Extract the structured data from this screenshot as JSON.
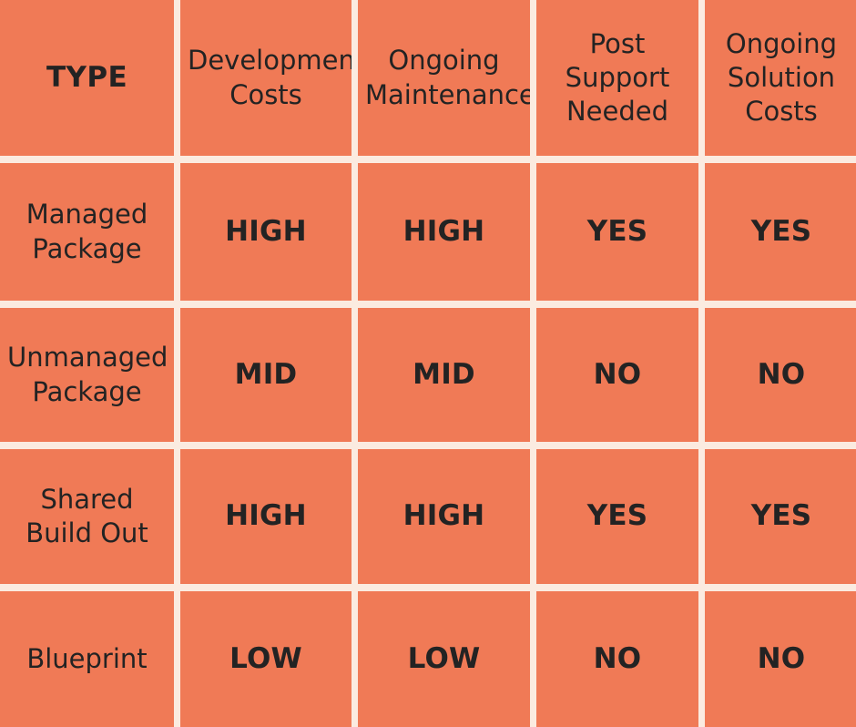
{
  "table": {
    "columns": [
      {
        "id": "type",
        "label": "TYPE",
        "style": "bold"
      },
      {
        "id": "development_costs",
        "label": "Development Costs",
        "style": "regular"
      },
      {
        "id": "ongoing_maintenance",
        "label": "Ongoing Maintenance",
        "style": "regular"
      },
      {
        "id": "post_support_needed",
        "label": "Post Support Needed",
        "style": "regular"
      },
      {
        "id": "ongoing_solution_costs",
        "label": "Ongoing Solution Costs",
        "style": "regular"
      }
    ],
    "rows": [
      {
        "type": "Managed Package",
        "development_costs": "HIGH",
        "ongoing_maintenance": "HIGH",
        "post_support_needed": "YES",
        "ongoing_solution_costs": "YES"
      },
      {
        "type": "Unmanaged Package",
        "development_costs": "MID",
        "ongoing_maintenance": "MID",
        "post_support_needed": "NO",
        "ongoing_solution_costs": "NO"
      },
      {
        "type": "Shared Build Out",
        "development_costs": "HIGH",
        "ongoing_maintenance": "HIGH",
        "post_support_needed": "YES",
        "ongoing_solution_costs": "YES"
      },
      {
        "type": "Blueprint",
        "development_costs": "LOW",
        "ongoing_maintenance": "LOW",
        "post_support_needed": "NO",
        "ongoing_solution_costs": "NO"
      }
    ]
  },
  "colors": {
    "cell_background": "#f07a56",
    "grid_gap": "#fbebe0",
    "text": "#232323"
  }
}
